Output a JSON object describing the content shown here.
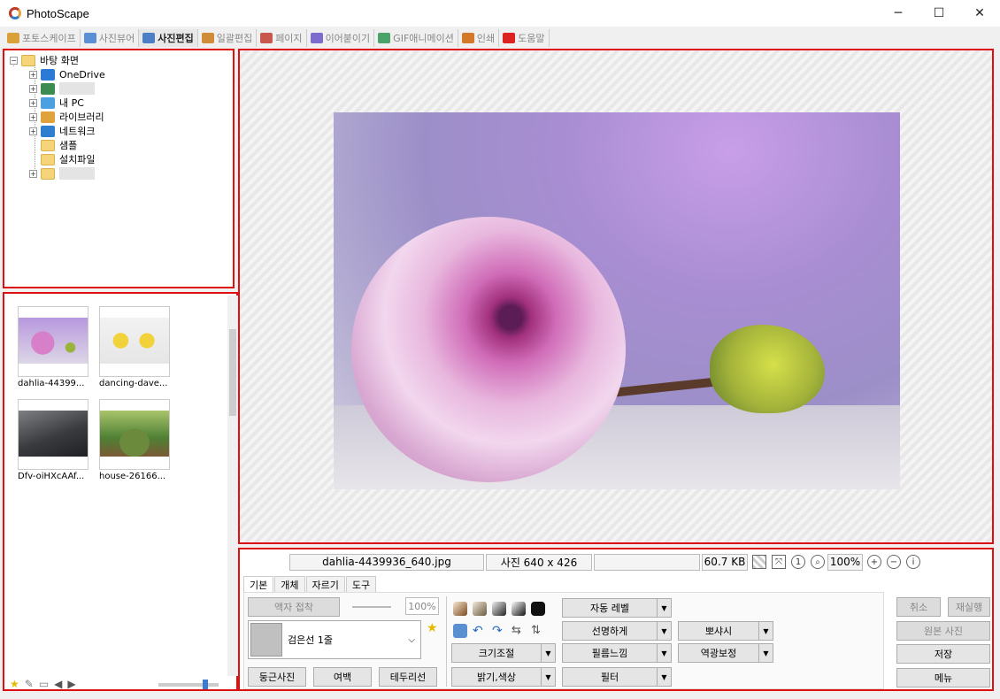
{
  "window": {
    "title": "PhotoScape",
    "minimize": "─",
    "maximize": "☐",
    "close": "✕"
  },
  "main_tabs": [
    {
      "label": "포토스케이프",
      "active": false,
      "icon": "photoscape-home-icon",
      "color": "#d9a13a"
    },
    {
      "label": "사진뷰어",
      "active": false,
      "icon": "viewer-icon",
      "color": "#5b8fd6"
    },
    {
      "label": "사진편집",
      "active": true,
      "icon": "editor-icon",
      "color": "#4c7fc8"
    },
    {
      "label": "일괄편집",
      "active": false,
      "icon": "batch-icon",
      "color": "#d18c3a"
    },
    {
      "label": "페이지",
      "active": false,
      "icon": "page-icon",
      "color": "#c8584d"
    },
    {
      "label": "이어붙이기",
      "active": false,
      "icon": "combine-icon",
      "color": "#7d6bd0"
    },
    {
      "label": "GIF애니메이션",
      "active": false,
      "icon": "gif-icon",
      "color": "#4aa36b"
    },
    {
      "label": "인쇄",
      "active": false,
      "icon": "print-icon",
      "color": "#d37a2a"
    },
    {
      "label": "도움말",
      "active": false,
      "icon": "help-icon",
      "color": "#d22"
    }
  ],
  "tree": {
    "items": [
      {
        "label": "바탕 화면",
        "icon": "desktop-folder-icon"
      },
      {
        "label": "OneDrive",
        "icon": "onedrive-cloud-icon"
      },
      {
        "label": "",
        "icon": "user-folder-icon"
      },
      {
        "label": "내 PC",
        "icon": "pc-icon"
      },
      {
        "label": "라이브러리",
        "icon": "library-icon"
      },
      {
        "label": "네트워크",
        "icon": "network-icon"
      },
      {
        "label": "샘플",
        "icon": "folder-icon"
      },
      {
        "label": "설치파일",
        "icon": "folder-icon"
      },
      {
        "label": "",
        "icon": "folder-icon"
      }
    ]
  },
  "thumbnails": [
    {
      "label": "dahlia-44399..."
    },
    {
      "label": "dancing-dave..."
    },
    {
      "label": "Dfv-oiHXcAAf..."
    },
    {
      "label": "house-26166..."
    }
  ],
  "status": {
    "filename": "dahlia-4439936_640.jpg",
    "dimensions": "사진 640 x 426",
    "extra": "",
    "filesize": "60.7 KB",
    "zoom": "100%"
  },
  "edit_tabs": [
    {
      "label": "기본",
      "active": true
    },
    {
      "label": "개체",
      "active": false
    },
    {
      "label": "자르기",
      "active": false
    },
    {
      "label": "도구",
      "active": false
    }
  ],
  "basic": {
    "frame_button": "액자 접착",
    "frame_percent": "100%",
    "frame_name": "검은선 1줄",
    "round_button": "둥근사진",
    "margin_button": "여백",
    "border_button": "테두리선"
  },
  "adjust": {
    "auto_level": "자동 레벨",
    "sharpen": "선명하게",
    "bloom": "뽀샤시",
    "resize": "크기조절",
    "film": "필름느낌",
    "backlight": "역광보정",
    "brightness": "밝기,색상",
    "filter": "필터"
  },
  "actions": {
    "undo": "취소",
    "redo": "재실행",
    "original": "원본 사진",
    "save": "저장",
    "menu": "메뉴"
  },
  "colors": {
    "highlight_border": "#d11",
    "accent": "#3a7bd5"
  }
}
